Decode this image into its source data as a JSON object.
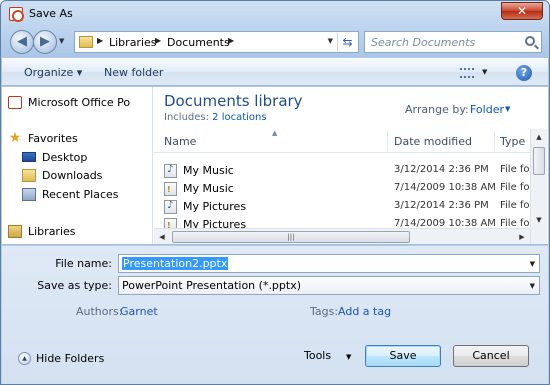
{
  "window": {
    "title": "Save As",
    "close_label": "✕"
  },
  "address": {
    "crumbs": [
      "Libraries",
      "Documents"
    ],
    "search_placeholder": "Search Documents"
  },
  "toolbar": {
    "organize": "Organize ▾",
    "new_folder": "New folder"
  },
  "nav": {
    "office": "Microsoft Office Po",
    "favorites": "Favorites",
    "desktop": "Desktop",
    "downloads": "Downloads",
    "recent": "Recent Places",
    "libraries": "Libraries"
  },
  "library": {
    "title": "Documents library",
    "includes_label": "Includes:",
    "includes_link": "2 locations",
    "arrange_label": "Arrange by:",
    "arrange_value": "Folder"
  },
  "columns": {
    "name": "Name",
    "date": "Date modified",
    "type": "Type"
  },
  "files": [
    {
      "name": "My Music",
      "date": "3/12/2014 2:36 PM",
      "type": "File folder",
      "icon": "music"
    },
    {
      "name": "My Music",
      "date": "7/14/2009 10:38 AM",
      "type": "File folder",
      "icon": "warn"
    },
    {
      "name": "My Pictures",
      "date": "3/12/2014 2:36 PM",
      "type": "File folder",
      "icon": "music"
    },
    {
      "name": "My Pictures",
      "date": "7/14/2009 10:38 AM",
      "type": "File folder",
      "icon": "warn"
    }
  ],
  "form": {
    "filename_label": "File name:",
    "filename_value": "Presentation2.pptx",
    "savetype_label": "Save as type:",
    "savetype_value": "PowerPoint Presentation (*.pptx)",
    "authors_label": "Authors:",
    "authors_value": "Garnet",
    "tags_label": "Tags:",
    "tags_value": "Add a tag"
  },
  "footer": {
    "hide_folders": "Hide Folders",
    "tools": "Tools",
    "save": "Save",
    "cancel": "Cancel"
  }
}
